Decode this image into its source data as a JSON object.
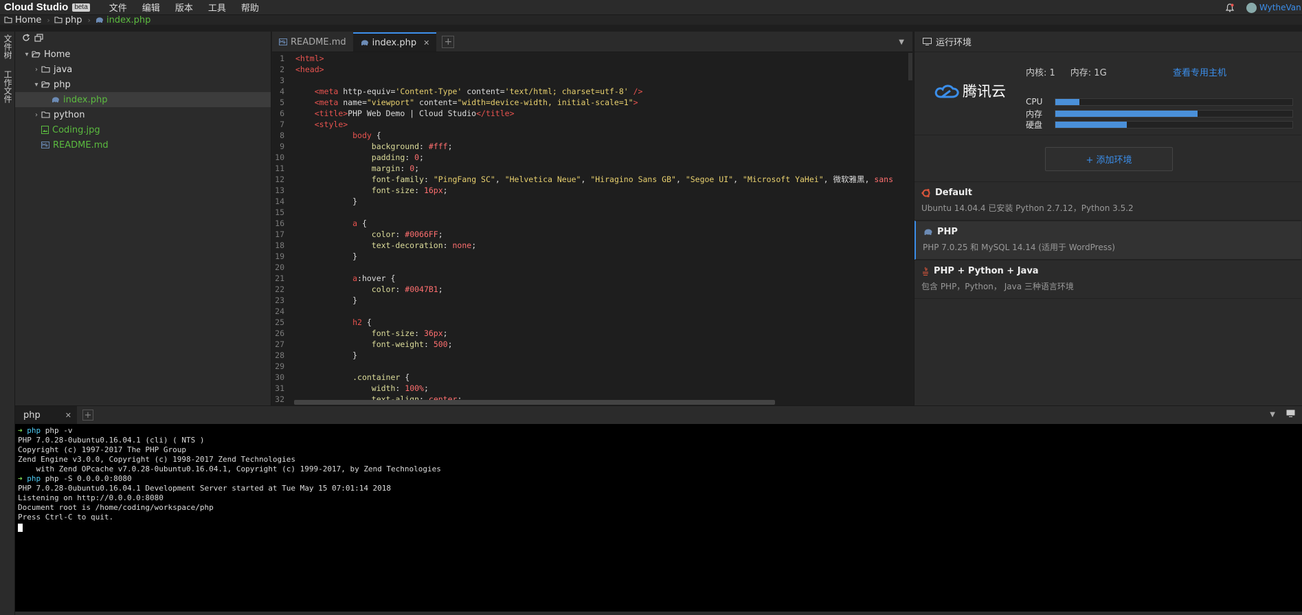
{
  "menubar": {
    "brand": "Cloud Studio",
    "beta": "beta",
    "items": [
      "文件",
      "编辑",
      "版本",
      "工具",
      "帮助"
    ],
    "username": "WytheVan"
  },
  "breadcrumb": [
    "Home",
    "php",
    "index.php"
  ],
  "leftrail": {
    "tabs": [
      "文件树",
      "工作文件"
    ]
  },
  "filetree": {
    "items": [
      {
        "label": "Home",
        "type": "folder-open",
        "depth": 0
      },
      {
        "label": "java",
        "type": "folder",
        "depth": 1
      },
      {
        "label": "php",
        "type": "folder-open",
        "depth": 1
      },
      {
        "label": "index.php",
        "type": "php-file",
        "depth": 2,
        "selected": true
      },
      {
        "label": "python",
        "type": "folder",
        "depth": 1
      },
      {
        "label": "Coding.jpg",
        "type": "image-file",
        "depth": 1
      },
      {
        "label": "README.md",
        "type": "md-file",
        "depth": 1
      }
    ]
  },
  "editor": {
    "tabs": [
      {
        "label": "README.md",
        "active": false
      },
      {
        "label": "index.php",
        "active": true
      }
    ],
    "lines": [
      [
        [
          "t-tag",
          "<html>"
        ]
      ],
      [
        [
          "t-tag",
          "<head>"
        ]
      ],
      [],
      [
        [
          "t-txt",
          "    "
        ],
        [
          "t-tag",
          "<meta "
        ],
        [
          "t-attr",
          "http-equiv="
        ],
        [
          "t-str",
          "'Content-Type'"
        ],
        [
          "t-attr",
          " content="
        ],
        [
          "t-str",
          "'text/html; charset=utf-8'"
        ],
        [
          "t-tag",
          " />"
        ]
      ],
      [
        [
          "t-txt",
          "    "
        ],
        [
          "t-tag",
          "<meta "
        ],
        [
          "t-attr",
          "name="
        ],
        [
          "t-str",
          "\"viewport\""
        ],
        [
          "t-attr",
          " content="
        ],
        [
          "t-str",
          "\"width=device-width, initial-scale=1\""
        ],
        [
          "t-tag",
          ">"
        ]
      ],
      [
        [
          "t-txt",
          "    "
        ],
        [
          "t-tag",
          "<title>"
        ],
        [
          "t-txt",
          "PHP Web Demo | Cloud Studio"
        ],
        [
          "t-tag",
          "</title>"
        ]
      ],
      [
        [
          "t-txt",
          "    "
        ],
        [
          "t-tag",
          "<style>"
        ]
      ],
      [
        [
          "t-txt",
          "            "
        ],
        [
          "t-sel",
          "body"
        ],
        [
          "t-txt",
          " {"
        ]
      ],
      [
        [
          "t-txt",
          "                "
        ],
        [
          "t-prop",
          "background"
        ],
        [
          "t-txt",
          ": "
        ],
        [
          "t-num",
          "#fff"
        ],
        [
          "t-txt",
          ";"
        ]
      ],
      [
        [
          "t-txt",
          "                "
        ],
        [
          "t-prop",
          "padding"
        ],
        [
          "t-txt",
          ": "
        ],
        [
          "t-num",
          "0"
        ],
        [
          "t-txt",
          ";"
        ]
      ],
      [
        [
          "t-txt",
          "                "
        ],
        [
          "t-prop",
          "margin"
        ],
        [
          "t-txt",
          ": "
        ],
        [
          "t-num",
          "0"
        ],
        [
          "t-txt",
          ";"
        ]
      ],
      [
        [
          "t-txt",
          "                "
        ],
        [
          "t-prop",
          "font-family"
        ],
        [
          "t-txt",
          ": "
        ],
        [
          "t-str",
          "\"PingFang SC\""
        ],
        [
          "t-txt",
          ", "
        ],
        [
          "t-str",
          "\"Helvetica Neue\""
        ],
        [
          "t-txt",
          ", "
        ],
        [
          "t-str",
          "\"Hiragino Sans GB\""
        ],
        [
          "t-txt",
          ", "
        ],
        [
          "t-str",
          "\"Segoe UI\""
        ],
        [
          "t-txt",
          ", "
        ],
        [
          "t-str",
          "\"Microsoft YaHei\""
        ],
        [
          "t-txt",
          ", 微软雅黑, "
        ],
        [
          "t-num",
          "sans"
        ]
      ],
      [
        [
          "t-txt",
          "                "
        ],
        [
          "t-prop",
          "font-size"
        ],
        [
          "t-txt",
          ": "
        ],
        [
          "t-num",
          "16px"
        ],
        [
          "t-txt",
          ";"
        ]
      ],
      [
        [
          "t-txt",
          "            }"
        ]
      ],
      [],
      [
        [
          "t-txt",
          "            "
        ],
        [
          "t-sel",
          "a"
        ],
        [
          "t-txt",
          " {"
        ]
      ],
      [
        [
          "t-txt",
          "                "
        ],
        [
          "t-prop",
          "color"
        ],
        [
          "t-txt",
          ": "
        ],
        [
          "t-num",
          "#0066FF"
        ],
        [
          "t-txt",
          ";"
        ]
      ],
      [
        [
          "t-txt",
          "                "
        ],
        [
          "t-prop",
          "text-decoration"
        ],
        [
          "t-txt",
          ": "
        ],
        [
          "t-num",
          "none"
        ],
        [
          "t-txt",
          ";"
        ]
      ],
      [
        [
          "t-txt",
          "            }"
        ]
      ],
      [],
      [
        [
          "t-txt",
          "            "
        ],
        [
          "t-sel",
          "a"
        ],
        [
          "t-txt",
          ":hover {"
        ]
      ],
      [
        [
          "t-txt",
          "                "
        ],
        [
          "t-prop",
          "color"
        ],
        [
          "t-txt",
          ": "
        ],
        [
          "t-num",
          "#0047B1"
        ],
        [
          "t-txt",
          ";"
        ]
      ],
      [
        [
          "t-txt",
          "            }"
        ]
      ],
      [],
      [
        [
          "t-txt",
          "            "
        ],
        [
          "t-sel",
          "h2"
        ],
        [
          "t-txt",
          " {"
        ]
      ],
      [
        [
          "t-txt",
          "                "
        ],
        [
          "t-prop",
          "font-size"
        ],
        [
          "t-txt",
          ": "
        ],
        [
          "t-num",
          "36px"
        ],
        [
          "t-txt",
          ";"
        ]
      ],
      [
        [
          "t-txt",
          "                "
        ],
        [
          "t-prop",
          "font-weight"
        ],
        [
          "t-txt",
          ": "
        ],
        [
          "t-num",
          "500"
        ],
        [
          "t-txt",
          ";"
        ]
      ],
      [
        [
          "t-txt",
          "            }"
        ]
      ],
      [],
      [
        [
          "t-txt",
          "            "
        ],
        [
          "t-prop",
          ".container"
        ],
        [
          "t-txt",
          " {"
        ]
      ],
      [
        [
          "t-txt",
          "                "
        ],
        [
          "t-prop",
          "width"
        ],
        [
          "t-txt",
          ": "
        ],
        [
          "t-num",
          "100%"
        ],
        [
          "t-txt",
          ";"
        ]
      ],
      [
        [
          "t-txt",
          "                "
        ],
        [
          "t-prop",
          "text-align"
        ],
        [
          "t-txt",
          ": "
        ],
        [
          "t-num",
          "center"
        ],
        [
          "t-txt",
          ";"
        ]
      ]
    ]
  },
  "envpanel": {
    "title": "运行环境",
    "logo_text": "腾讯云",
    "cores": "内核: 1",
    "memory": "内存: 1G",
    "dedicated_link": "查看专用主机",
    "resources": [
      {
        "label": "CPU",
        "level": 0.1
      },
      {
        "label": "内存",
        "level": 0.6
      },
      {
        "label": "硬盘",
        "level": 0.3
      }
    ],
    "add_button": "+ 添加环境",
    "envs": [
      {
        "title": "Default",
        "desc": "Ubuntu 14.04.4 已安装 Python 2.7.12，Python 3.5.2",
        "icon": "ubuntu-icon",
        "active": false
      },
      {
        "title": "PHP",
        "desc": "PHP 7.0.25 和 MySQL 14.14 (适用于 WordPress)",
        "icon": "php-elephant-icon",
        "active": true
      },
      {
        "title": "PHP + Python + Java",
        "desc": "包含 PHP，Python， Java 三种语言环境",
        "icon": "java-icon",
        "active": false
      }
    ]
  },
  "terminal": {
    "tab": "php",
    "lines": [
      {
        "prompt": true,
        "cwd": "php",
        "cmd": "php -v"
      },
      {
        "text": "PHP 7.0.28-0ubuntu0.16.04.1 (cli) ( NTS )"
      },
      {
        "text": "Copyright (c) 1997-2017 The PHP Group"
      },
      {
        "text": "Zend Engine v3.0.0, Copyright (c) 1998-2017 Zend Technologies"
      },
      {
        "text": "    with Zend OPcache v7.0.28-0ubuntu0.16.04.1, Copyright (c) 1999-2017, by Zend Technologies"
      },
      {
        "prompt": true,
        "cwd": "php",
        "cmd": "php -S 0.0.0.0:8080"
      },
      {
        "text": "PHP 7.0.28-0ubuntu0.16.04.1 Development Server started at Tue May 15 07:01:14 2018"
      },
      {
        "text": "Listening on http://0.0.0.0:8080"
      },
      {
        "text": "Document root is /home/coding/workspace/php"
      },
      {
        "text": "Press Ctrl-C to quit."
      }
    ]
  },
  "colors": {
    "accent": "#3b8eea",
    "green": "#5bbb3f",
    "bar": "#4a90d9"
  }
}
